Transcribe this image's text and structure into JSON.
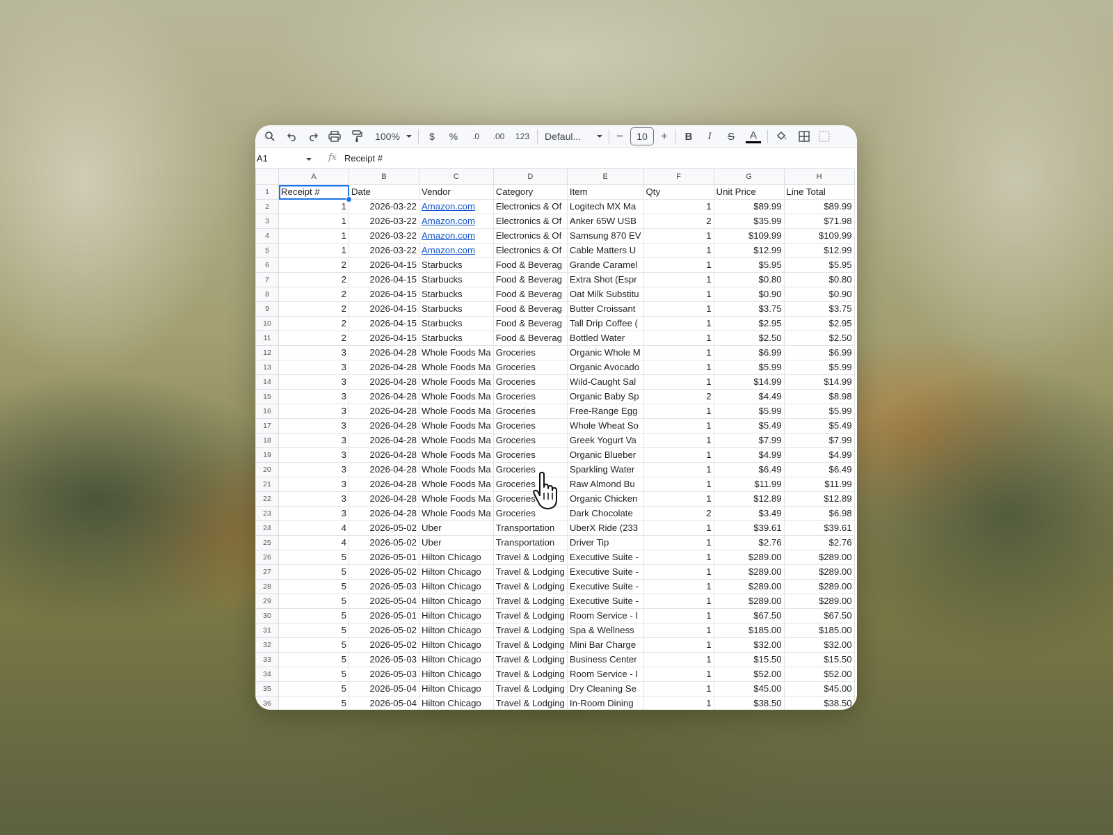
{
  "toolbar": {
    "zoom": "100%",
    "currency": "$",
    "percent": "%",
    "decrease_decimals": ".0",
    "increase_decimals": ".00",
    "number_format": "123",
    "font": "Defaul...",
    "font_size": "10",
    "minus": "−",
    "plus": "+",
    "bold": "B",
    "italic": "I",
    "strikethrough": "S",
    "text_color": "A"
  },
  "formula_bar": {
    "cell_ref": "A1",
    "fx": "fx",
    "content": "Receipt #"
  },
  "columns": [
    "A",
    "B",
    "C",
    "D",
    "E",
    "F",
    "G",
    "H"
  ],
  "rows": [
    {
      "n": "1",
      "cells": [
        "Receipt #",
        "Date",
        "Vendor",
        "Category",
        "Item",
        "Qty",
        "Unit Price",
        "Line Total"
      ]
    },
    {
      "n": "2",
      "cells": [
        "1",
        "2026-03-22",
        "Amazon.com",
        "Electronics & Of",
        "Logitech MX Ma",
        "1",
        "$89.99",
        "$89.99"
      ]
    },
    {
      "n": "3",
      "cells": [
        "1",
        "2026-03-22",
        "Amazon.com",
        "Electronics & Of",
        "Anker 65W USB",
        "2",
        "$35.99",
        "$71.98"
      ]
    },
    {
      "n": "4",
      "cells": [
        "1",
        "2026-03-22",
        "Amazon.com",
        "Electronics & Of",
        "Samsung 870 EV",
        "1",
        "$109.99",
        "$109.99"
      ]
    },
    {
      "n": "5",
      "cells": [
        "1",
        "2026-03-22",
        "Amazon.com",
        "Electronics & Of",
        "Cable Matters U",
        "1",
        "$12.99",
        "$12.99"
      ]
    },
    {
      "n": "6",
      "cells": [
        "2",
        "2026-04-15",
        "Starbucks",
        "Food & Beverag",
        "Grande Caramel",
        "1",
        "$5.95",
        "$5.95"
      ]
    },
    {
      "n": "7",
      "cells": [
        "2",
        "2026-04-15",
        "Starbucks",
        "Food & Beverag",
        "Extra Shot (Espr",
        "1",
        "$0.80",
        "$0.80"
      ]
    },
    {
      "n": "8",
      "cells": [
        "2",
        "2026-04-15",
        "Starbucks",
        "Food & Beverag",
        "Oat Milk Substitu",
        "1",
        "$0.90",
        "$0.90"
      ]
    },
    {
      "n": "9",
      "cells": [
        "2",
        "2026-04-15",
        "Starbucks",
        "Food & Beverag",
        "Butter Croissant",
        "1",
        "$3.75",
        "$3.75"
      ]
    },
    {
      "n": "10",
      "cells": [
        "2",
        "2026-04-15",
        "Starbucks",
        "Food & Beverag",
        "Tall Drip Coffee (",
        "1",
        "$2.95",
        "$2.95"
      ]
    },
    {
      "n": "11",
      "cells": [
        "2",
        "2026-04-15",
        "Starbucks",
        "Food & Beverag",
        "Bottled Water",
        "1",
        "$2.50",
        "$2.50"
      ]
    },
    {
      "n": "12",
      "cells": [
        "3",
        "2026-04-28",
        "Whole Foods Ma",
        "Groceries",
        "Organic Whole M",
        "1",
        "$6.99",
        "$6.99"
      ]
    },
    {
      "n": "13",
      "cells": [
        "3",
        "2026-04-28",
        "Whole Foods Ma",
        "Groceries",
        "Organic Avocado",
        "1",
        "$5.99",
        "$5.99"
      ]
    },
    {
      "n": "14",
      "cells": [
        "3",
        "2026-04-28",
        "Whole Foods Ma",
        "Groceries",
        "Wild-Caught Sal",
        "1",
        "$14.99",
        "$14.99"
      ]
    },
    {
      "n": "15",
      "cells": [
        "3",
        "2026-04-28",
        "Whole Foods Ma",
        "Groceries",
        "Organic Baby Sp",
        "2",
        "$4.49",
        "$8.98"
      ]
    },
    {
      "n": "16",
      "cells": [
        "3",
        "2026-04-28",
        "Whole Foods Ma",
        "Groceries",
        "Free-Range Egg",
        "1",
        "$5.99",
        "$5.99"
      ]
    },
    {
      "n": "17",
      "cells": [
        "3",
        "2026-04-28",
        "Whole Foods Ma",
        "Groceries",
        "Whole Wheat So",
        "1",
        "$5.49",
        "$5.49"
      ]
    },
    {
      "n": "18",
      "cells": [
        "3",
        "2026-04-28",
        "Whole Foods Ma",
        "Groceries",
        "Greek Yogurt Va",
        "1",
        "$7.99",
        "$7.99"
      ]
    },
    {
      "n": "19",
      "cells": [
        "3",
        "2026-04-28",
        "Whole Foods Ma",
        "Groceries",
        "Organic Blueber",
        "1",
        "$4.99",
        "$4.99"
      ]
    },
    {
      "n": "20",
      "cells": [
        "3",
        "2026-04-28",
        "Whole Foods Ma",
        "Groceries",
        "Sparkling Water",
        "1",
        "$6.49",
        "$6.49"
      ]
    },
    {
      "n": "21",
      "cells": [
        "3",
        "2026-04-28",
        "Whole Foods Ma",
        "Groceries",
        "Raw Almond Bu",
        "1",
        "$11.99",
        "$11.99"
      ]
    },
    {
      "n": "22",
      "cells": [
        "3",
        "2026-04-28",
        "Whole Foods Ma",
        "Groceries",
        "Organic Chicken",
        "1",
        "$12.89",
        "$12.89"
      ]
    },
    {
      "n": "23",
      "cells": [
        "3",
        "2026-04-28",
        "Whole Foods Ma",
        "Groceries",
        "Dark Chocolate",
        "2",
        "$3.49",
        "$6.98"
      ]
    },
    {
      "n": "24",
      "cells": [
        "4",
        "2026-05-02",
        "Uber",
        "Transportation",
        "UberX Ride (233",
        "1",
        "$39.61",
        "$39.61"
      ]
    },
    {
      "n": "25",
      "cells": [
        "4",
        "2026-05-02",
        "Uber",
        "Transportation",
        "Driver Tip",
        "1",
        "$2.76",
        "$2.76"
      ]
    },
    {
      "n": "26",
      "cells": [
        "5",
        "2026-05-01",
        "Hilton Chicago",
        "Travel & Lodging",
        "Executive Suite -",
        "1",
        "$289.00",
        "$289.00"
      ]
    },
    {
      "n": "27",
      "cells": [
        "5",
        "2026-05-02",
        "Hilton Chicago",
        "Travel & Lodging",
        "Executive Suite -",
        "1",
        "$289.00",
        "$289.00"
      ]
    },
    {
      "n": "28",
      "cells": [
        "5",
        "2026-05-03",
        "Hilton Chicago",
        "Travel & Lodging",
        "Executive Suite -",
        "1",
        "$289.00",
        "$289.00"
      ]
    },
    {
      "n": "29",
      "cells": [
        "5",
        "2026-05-04",
        "Hilton Chicago",
        "Travel & Lodging",
        "Executive Suite -",
        "1",
        "$289.00",
        "$289.00"
      ]
    },
    {
      "n": "30",
      "cells": [
        "5",
        "2026-05-01",
        "Hilton Chicago",
        "Travel & Lodging",
        "Room Service - I",
        "1",
        "$67.50",
        "$67.50"
      ]
    },
    {
      "n": "31",
      "cells": [
        "5",
        "2026-05-02",
        "Hilton Chicago",
        "Travel & Lodging",
        "Spa & Wellness",
        "1",
        "$185.00",
        "$185.00"
      ]
    },
    {
      "n": "32",
      "cells": [
        "5",
        "2026-05-02",
        "Hilton Chicago",
        "Travel & Lodging",
        "Mini Bar Charge",
        "1",
        "$32.00",
        "$32.00"
      ]
    },
    {
      "n": "33",
      "cells": [
        "5",
        "2026-05-03",
        "Hilton Chicago",
        "Travel & Lodging",
        "Business Center",
        "1",
        "$15.50",
        "$15.50"
      ]
    },
    {
      "n": "34",
      "cells": [
        "5",
        "2026-05-03",
        "Hilton Chicago",
        "Travel & Lodging",
        "Room Service - I",
        "1",
        "$52.00",
        "$52.00"
      ]
    },
    {
      "n": "35",
      "cells": [
        "5",
        "2026-05-04",
        "Hilton Chicago",
        "Travel & Lodging",
        "Dry Cleaning Se",
        "1",
        "$45.00",
        "$45.00"
      ]
    },
    {
      "n": "36",
      "cells": [
        "5",
        "2026-05-04",
        "Hilton Chicago",
        "Travel & Lodging",
        "In-Room Dining",
        "1",
        "$38.50",
        "$38.50"
      ]
    }
  ],
  "colors": {
    "selection": "#1a73e8",
    "link": "#1155cc",
    "header_bg": "#f8f9fa"
  }
}
